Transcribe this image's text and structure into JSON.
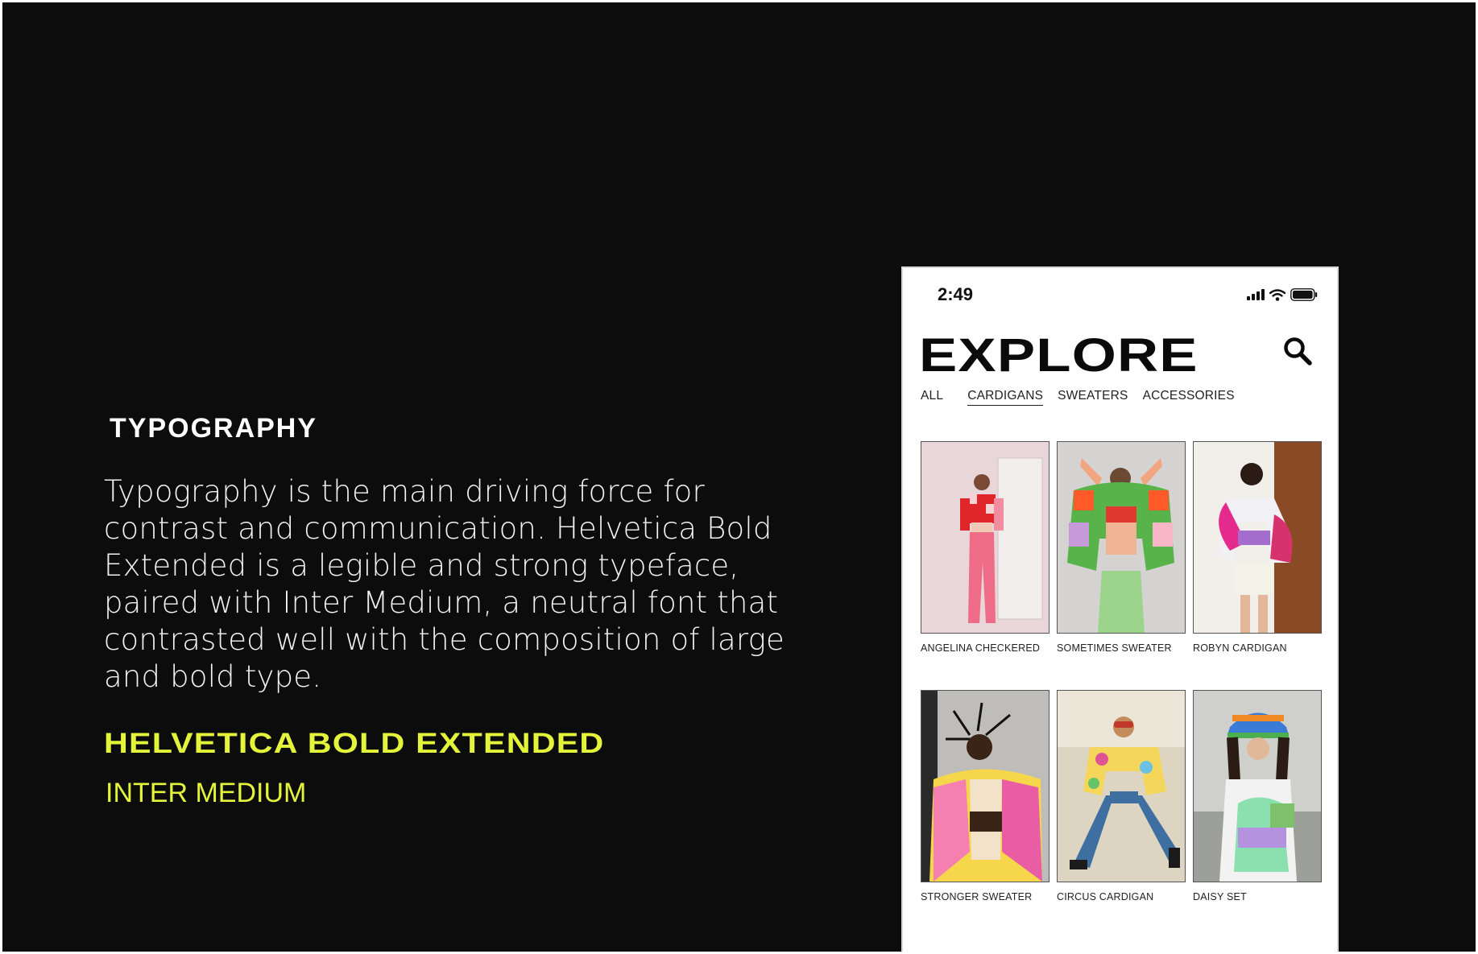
{
  "section": {
    "title": "TYPOGRAPHY",
    "body": "Typography is the main driving force for contrast and communication. Helvetica Bold Extended is a legible and strong typeface, paired with Inter Medium, a neutral font that contrasted well with the composition of large and bold type.",
    "font_primary": "HELVETICA BOLD EXTENDED",
    "font_secondary": "INTER MEDIUM",
    "accent_color": "#e3f43a"
  },
  "phone": {
    "status": {
      "time": "2:49",
      "icons": [
        "cellular-signal-icon",
        "wifi-icon",
        "battery-icon"
      ]
    },
    "title": "EXPLORE",
    "search_icon": "search-icon",
    "tabs": [
      {
        "label": "ALL",
        "active": false
      },
      {
        "label": "CARDIGANS",
        "active": true
      },
      {
        "label": "SWEATERS",
        "active": false
      },
      {
        "label": "ACCESSORIES",
        "active": false
      }
    ],
    "products": [
      {
        "name": "ANGELINA CHECKERED"
      },
      {
        "name": "SOMETIMES SWEATER"
      },
      {
        "name": "ROBYN CARDIGAN"
      },
      {
        "name": "STRONGER SWEATER"
      },
      {
        "name": "CIRCUS CARDIGAN"
      },
      {
        "name": "DAISY SET"
      }
    ]
  }
}
